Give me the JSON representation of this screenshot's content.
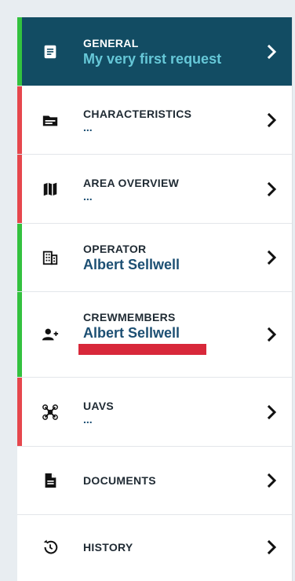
{
  "colors": {
    "status_ok": "#33c13f",
    "status_error": "#e6474d",
    "active_background": "#124c63",
    "value_text": "#1c4f73",
    "active_value_text": "#66c8d8",
    "highlight": "#d8283a"
  },
  "sidebar": {
    "items": [
      {
        "title": "GENERAL",
        "value": "My very first request",
        "icon": "document-icon",
        "status": "ok",
        "active": true
      },
      {
        "title": "CHARACTERISTICS",
        "value": "...",
        "icon": "card-icon",
        "status": "error"
      },
      {
        "title": "AREA OVERVIEW",
        "value": "...",
        "icon": "map-icon",
        "status": "error"
      },
      {
        "title": "OPERATOR",
        "value": "Albert Sellwell",
        "icon": "building-icon",
        "status": "ok"
      },
      {
        "title": "CREWMEMBERS",
        "value": "Albert Sellwell",
        "icon": "add-person-icon",
        "status": "ok"
      },
      {
        "title": "UAVS",
        "value": "...",
        "icon": "drone-icon",
        "status": "error"
      },
      {
        "title": "DOCUMENTS",
        "icon": "file-icon",
        "status": "none"
      },
      {
        "title": "HISTORY",
        "icon": "history-icon",
        "status": "none"
      }
    ]
  }
}
